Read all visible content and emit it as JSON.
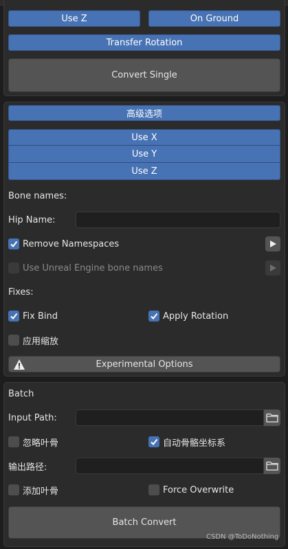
{
  "top_panel": {
    "use_z_label": "Use Z",
    "on_ground_label": "On Ground",
    "transfer_rotation_label": "Transfer Rotation",
    "convert_single_label": "Convert Single"
  },
  "advanced_panel": {
    "advanced_options_label": "高级选项",
    "axis_buttons": [
      "Use X",
      "Use Y",
      "Use Z"
    ],
    "bone_names_label": "Bone names:",
    "hip_name_label": "Hip Name:",
    "hip_name_value": "",
    "remove_namespaces_label": "Remove Namespaces",
    "remove_namespaces_checked": true,
    "use_unreal_label": "Use Unreal Engine bone names",
    "use_unreal_checked": false,
    "fixes_label": "Fixes:",
    "fix_bind_label": "Fix Bind",
    "fix_bind_checked": true,
    "apply_rotation_label": "Apply Rotation",
    "apply_rotation_checked": true,
    "apply_scale_label": "应用缩放",
    "apply_scale_checked": false,
    "experimental_label": "Experimental Options"
  },
  "batch_panel": {
    "title": "Batch",
    "input_path_label": "Input Path:",
    "input_path_value": "",
    "ignore_leaf_label": "忽略叶骨",
    "ignore_leaf_checked": false,
    "auto_bone_axis_label": "自动骨骼坐标系",
    "auto_bone_axis_checked": true,
    "output_path_label": "输出路径:",
    "output_path_value": "",
    "add_leaf_label": "添加叶骨",
    "add_leaf_checked": false,
    "force_overwrite_label": "Force Overwrite",
    "force_overwrite_checked": false,
    "batch_convert_label": "Batch Convert"
  },
  "watermark": "CSDN @ToDoNothing",
  "colors": {
    "accent": "#4772b3",
    "button": "#545454",
    "panel": "#2b2b2b",
    "background": "#1d1d1d"
  },
  "icons": {
    "checkbox_checked": "checkmark-icon",
    "play": "play-icon",
    "warning": "warning-icon",
    "folder": "folder-icon"
  }
}
